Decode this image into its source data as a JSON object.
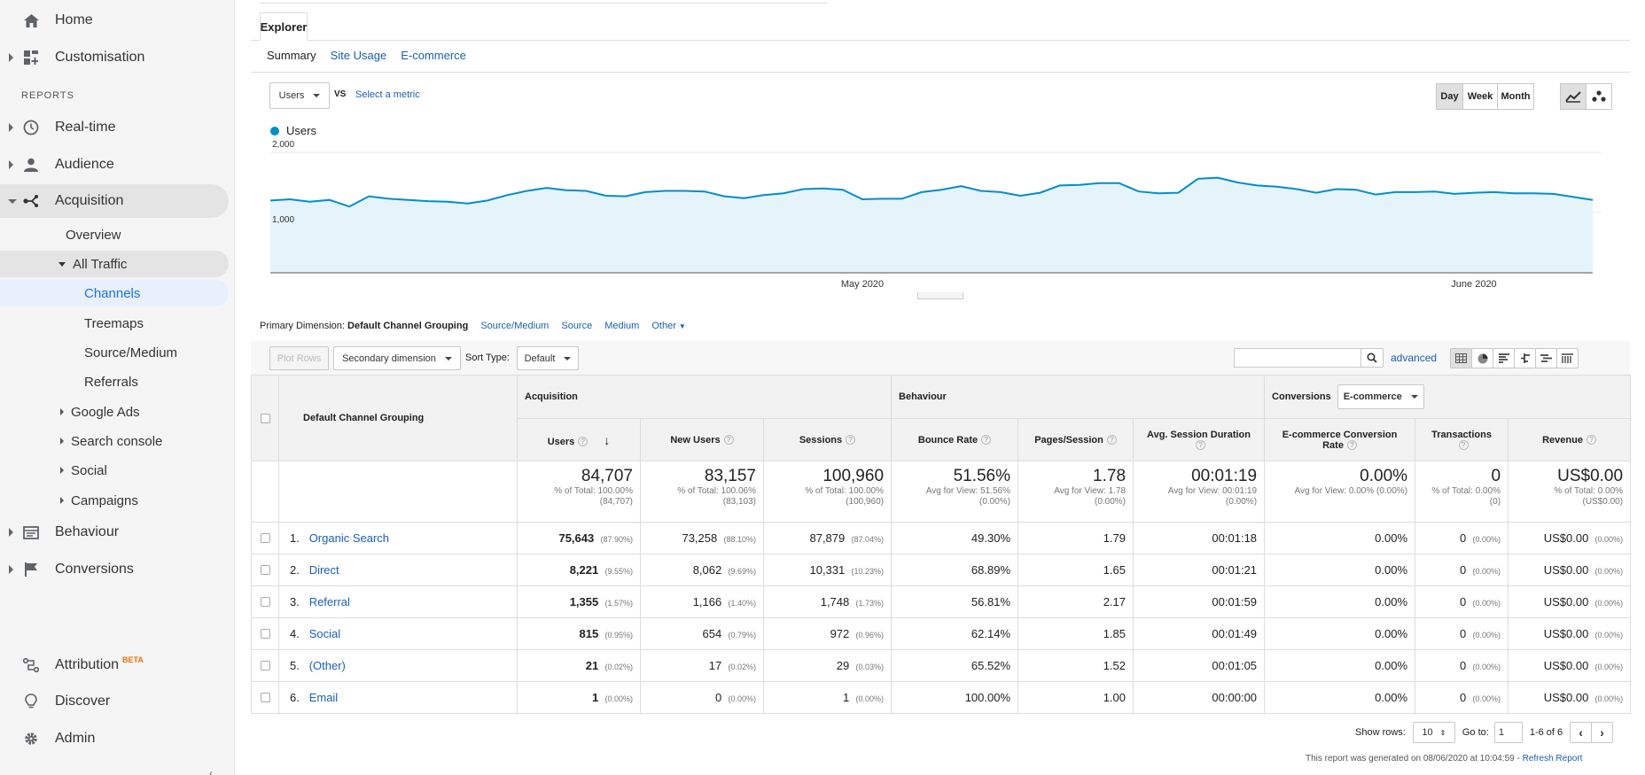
{
  "sidebar": {
    "home": "Home",
    "customisation": "Customisation",
    "reports_label": "REPORTS",
    "realtime": "Real-time",
    "audience": "Audience",
    "acquisition": "Acquisition",
    "overview": "Overview",
    "all_traffic": "All Traffic",
    "channels": "Channels",
    "treemaps": "Treemaps",
    "source_medium": "Source/Medium",
    "referrals": "Referrals",
    "google_ads": "Google Ads",
    "search_console": "Search console",
    "social": "Social",
    "campaigns": "Campaigns",
    "behaviour": "Behaviour",
    "conversions": "Conversions",
    "attribution": "Attribution",
    "beta": "BETA",
    "discover": "Discover",
    "admin": "Admin"
  },
  "explorer": {
    "tab": "Explorer",
    "subtabs": [
      "Summary",
      "Site Usage",
      "E-commerce"
    ],
    "metric_select": "Users",
    "vs": "VS",
    "select_metric": "Select a metric",
    "periods": [
      "Day",
      "Week",
      "Month"
    ]
  },
  "chart_data": {
    "type": "area",
    "series": [
      {
        "name": "Users",
        "values": [
          1200,
          1220,
          1180,
          1210,
          1100,
          1270,
          1230,
          1210,
          1190,
          1180,
          1150,
          1200,
          1290,
          1360,
          1410,
          1370,
          1360,
          1280,
          1270,
          1340,
          1360,
          1360,
          1350,
          1270,
          1240,
          1290,
          1320,
          1390,
          1400,
          1380,
          1220,
          1230,
          1230,
          1340,
          1380,
          1440,
          1360,
          1340,
          1280,
          1330,
          1450,
          1460,
          1490,
          1490,
          1350,
          1320,
          1330,
          1560,
          1580,
          1500,
          1450,
          1430,
          1390,
          1330,
          1390,
          1380,
          1300,
          1340,
          1340,
          1350,
          1310,
          1330,
          1340,
          1320,
          1320,
          1310,
          1260,
          1210
        ]
      }
    ],
    "y_ticks": [
      "2,000",
      "1,000"
    ],
    "x_ticks": [
      "May 2020",
      "June 2020"
    ],
    "ylim": [
      0,
      2000
    ],
    "color": "#058dc7"
  },
  "primary_dimension": {
    "label": "Primary Dimension:",
    "current": "Default Channel Grouping",
    "options": [
      "Source/Medium",
      "Source",
      "Medium",
      "Other"
    ]
  },
  "toolbar": {
    "plot_rows": "Plot Rows",
    "secondary_dimension": "Secondary dimension",
    "sort_type_label": "Sort Type:",
    "sort_type": "Default",
    "advanced": "advanced"
  },
  "table": {
    "dim_header": "Default Channel Grouping",
    "groups": {
      "acquisition": "Acquisition",
      "behaviour": "Behaviour",
      "conversions": "Conversions",
      "ecommerce": "E-commerce"
    },
    "columns": [
      "Users",
      "New Users",
      "Sessions",
      "Bounce Rate",
      "Pages/Session",
      "Avg. Session Duration",
      "E-commerce Conversion Rate",
      "Transactions",
      "Revenue"
    ],
    "totals": [
      {
        "big": "84,707",
        "l1": "% of Total: 100.00%",
        "l2": "(84,707)"
      },
      {
        "big": "83,157",
        "l1": "% of Total: 100.06%",
        "l2": "(83,103)"
      },
      {
        "big": "100,960",
        "l1": "% of Total: 100.00%",
        "l2": "(100,960)"
      },
      {
        "big": "51.56%",
        "l1": "Avg for View: 51.56%",
        "l2": "(0.00%)"
      },
      {
        "big": "1.78",
        "l1": "Avg for View: 1.78",
        "l2": "(0.00%)"
      },
      {
        "big": "00:01:19",
        "l1": "Avg for View: 00:01:19",
        "l2": "(0.00%)"
      },
      {
        "big": "0.00%",
        "l1": "Avg for View: 0.00% (0.00%)",
        "l2": ""
      },
      {
        "big": "0",
        "l1": "% of Total: 0.00%",
        "l2": "(0)"
      },
      {
        "big": "US$0.00",
        "l1": "% of Total: 0.00%",
        "l2": "(US$0.00)"
      }
    ],
    "rows": [
      {
        "idx": "1.",
        "name": "Organic Search",
        "users": "75,643",
        "users_pct": "(87.90%)",
        "new_users": "73,258",
        "new_users_pct": "(88.10%)",
        "sessions": "87,879",
        "sessions_pct": "(87.04%)",
        "bounce": "49.30%",
        "pages": "1.79",
        "duration": "00:01:18",
        "conv": "0.00%",
        "trans": "0",
        "trans_pct": "(0.00%)",
        "revenue": "US$0.00",
        "revenue_pct": "(0.00%)"
      },
      {
        "idx": "2.",
        "name": "Direct",
        "users": "8,221",
        "users_pct": "(9.55%)",
        "new_users": "8,062",
        "new_users_pct": "(9.69%)",
        "sessions": "10,331",
        "sessions_pct": "(10.23%)",
        "bounce": "68.89%",
        "pages": "1.65",
        "duration": "00:01:21",
        "conv": "0.00%",
        "trans": "0",
        "trans_pct": "(0.00%)",
        "revenue": "US$0.00",
        "revenue_pct": "(0.00%)"
      },
      {
        "idx": "3.",
        "name": "Referral",
        "users": "1,355",
        "users_pct": "(1.57%)",
        "new_users": "1,166",
        "new_users_pct": "(1.40%)",
        "sessions": "1,748",
        "sessions_pct": "(1.73%)",
        "bounce": "56.81%",
        "pages": "2.17",
        "duration": "00:01:59",
        "conv": "0.00%",
        "trans": "0",
        "trans_pct": "(0.00%)",
        "revenue": "US$0.00",
        "revenue_pct": "(0.00%)"
      },
      {
        "idx": "4.",
        "name": "Social",
        "users": "815",
        "users_pct": "(0.95%)",
        "new_users": "654",
        "new_users_pct": "(0.79%)",
        "sessions": "972",
        "sessions_pct": "(0.96%)",
        "bounce": "62.14%",
        "pages": "1.85",
        "duration": "00:01:49",
        "conv": "0.00%",
        "trans": "0",
        "trans_pct": "(0.00%)",
        "revenue": "US$0.00",
        "revenue_pct": "(0.00%)"
      },
      {
        "idx": "5.",
        "name": "(Other)",
        "users": "21",
        "users_pct": "(0.02%)",
        "new_users": "17",
        "new_users_pct": "(0.02%)",
        "sessions": "29",
        "sessions_pct": "(0.03%)",
        "bounce": "65.52%",
        "pages": "1.52",
        "duration": "00:01:05",
        "conv": "0.00%",
        "trans": "0",
        "trans_pct": "(0.00%)",
        "revenue": "US$0.00",
        "revenue_pct": "(0.00%)"
      },
      {
        "idx": "6.",
        "name": "Email",
        "users": "1",
        "users_pct": "(0.00%)",
        "new_users": "0",
        "new_users_pct": "(0.00%)",
        "sessions": "1",
        "sessions_pct": "(0.00%)",
        "bounce": "100.00%",
        "pages": "1.00",
        "duration": "00:00:00",
        "conv": "0.00%",
        "trans": "0",
        "trans_pct": "(0.00%)",
        "revenue": "US$0.00",
        "revenue_pct": "(0.00%)"
      }
    ]
  },
  "pagination": {
    "show_rows_label": "Show rows:",
    "show_rows": "10",
    "goto_label": "Go to:",
    "goto": "1",
    "range": "1-6 of 6"
  },
  "generated": {
    "text": "This report was generated on 08/06/2020 at 10:04:59 -",
    "refresh": "Refresh Report"
  }
}
